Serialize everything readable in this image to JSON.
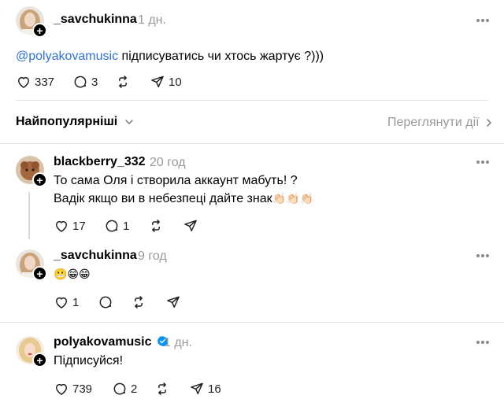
{
  "main_post": {
    "username": "_savchukinna",
    "time": "1 дн.",
    "mention": "@polyakovamusic",
    "text": " підписуватись чи хтось жартує ?)))",
    "likes": "337",
    "comments": "3",
    "shares": "10"
  },
  "sort": {
    "label": "Найпопулярніші",
    "view_activity": "Переглянути дії"
  },
  "replies": [
    {
      "username": "blackberry_332",
      "time": "20 год",
      "line1": "То сама Оля і створила аккаунт мабуть! ?",
      "line2": "Вадік якщо ви в небезпеці дайте знак",
      "line2_emoji": "👏🏻👏🏻👏🏻",
      "likes": "17",
      "comments": "1"
    },
    {
      "username": "_savchukinna",
      "time": "9 год",
      "line1": "😬😁😁",
      "likes": "1"
    },
    {
      "username": "polyakovamusic",
      "time": "1 дн.",
      "line1": "Підписуйся!",
      "likes": "739",
      "comments": "2",
      "shares": "16"
    }
  ],
  "colors": {
    "mention": "#2f6fde",
    "verified": "#0095f6",
    "muted": "#999999"
  },
  "icons": [
    "heart-icon",
    "comment-icon",
    "repost-icon",
    "send-icon",
    "more-icon",
    "follow-plus-icon",
    "verified-icon",
    "chevron-down-icon",
    "chevron-right-icon"
  ]
}
